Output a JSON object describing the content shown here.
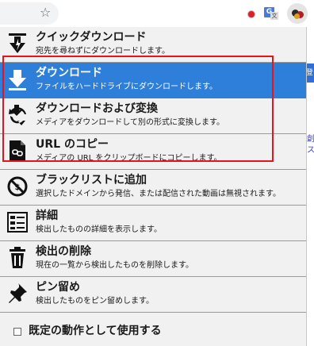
{
  "toolbar": {
    "star_icon": "☆"
  },
  "menu": {
    "items": [
      {
        "title": "クイックダウンロード",
        "desc": "宛先を尋ねずにダウンロードします。",
        "icon": "quick-download-icon",
        "active": false
      },
      {
        "title": "ダウンロード",
        "desc": "ファイルをハードドライブにダウンロードします。",
        "icon": "download-icon",
        "active": true
      },
      {
        "title": "ダウンロードおよび変換",
        "desc": "メディアをダウンロードして別の形式に変換します。",
        "icon": "download-convert-icon",
        "active": false
      },
      {
        "title": "URL のコピー",
        "desc": "メディアの URL をクリップボードにコピーします。",
        "icon": "copy-url-icon",
        "active": false
      },
      {
        "title": "ブラックリストに追加",
        "desc": "選択したドメインから発信、または配信された動画は無視されます。",
        "icon": "blacklist-icon",
        "active": false
      },
      {
        "title": "詳細",
        "desc": "検出したものの詳細を表示します。",
        "icon": "details-icon",
        "active": false
      },
      {
        "title": "検出の削除",
        "desc": "現在の一覧から検出したものを削除します。",
        "icon": "trash-icon",
        "active": false
      },
      {
        "title": "ピン留め",
        "desc": "検出したものをピン留めします。",
        "icon": "pin-icon",
        "active": false
      }
    ],
    "footer_label": "既定の動作として使用する",
    "footer_checked": false
  },
  "background": {
    "strip_text": "登",
    "link1": "創",
    "link2": "ス"
  },
  "colors": {
    "active_bg": "#2e7fd9",
    "highlight": "#e8141c",
    "menu_bg": "#f1f1f1"
  }
}
